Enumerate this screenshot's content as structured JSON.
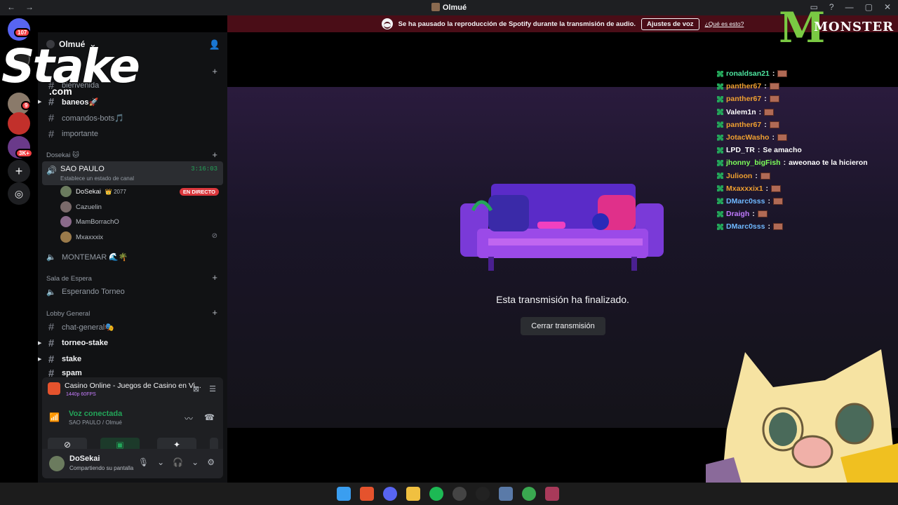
{
  "window": {
    "title": "Olmué"
  },
  "notice": {
    "text": "Se ha pausado la reproducción de Spotify durante la transmisión de audio.",
    "button": "Ajustes de voz",
    "link": "¿Qué es esto?"
  },
  "rail": {
    "badge_top": "107",
    "badge_mid": "9",
    "badge_low": "3K+"
  },
  "overlay": {
    "stake_word": "Stake",
    "stake_domain": ".com",
    "monster_word": "MONSTER",
    "monster_mark": "M"
  },
  "server": {
    "name": "Olmué"
  },
  "channels": {
    "top": [
      {
        "name": "bienvenida"
      },
      {
        "name": "baneos🚀"
      },
      {
        "name": "comandos-bots🎵"
      },
      {
        "name": "importante"
      }
    ],
    "cat_dosekai": "Dosekai 🐱",
    "voice_active": {
      "name": "SAO PAULO",
      "status": "Establece un estado de canal",
      "time": "3:16:03"
    },
    "voice_users": [
      {
        "name": "DoSekai",
        "extra": "👑 2077",
        "live": "EN DIRECTO"
      },
      {
        "name": "Cazuelin"
      },
      {
        "name": "MamBorrachO"
      },
      {
        "name": "Mxaxxxix"
      }
    ],
    "montemar": "MONTEMAR 🌊🌴",
    "cat_sala": "Sala de Espera",
    "esperando": "Esperando Torneo",
    "cat_lobby": "Lobby General",
    "lobby": [
      {
        "name": "chat-general🎭"
      },
      {
        "name": "torneo-stake"
      },
      {
        "name": "stake"
      },
      {
        "name": "spam"
      }
    ]
  },
  "stream_panel": {
    "title": "Casino Online - Juegos de Casino en Vi...",
    "quality": "1440p 60FPS"
  },
  "voice_panel": {
    "status": "Voz conectada",
    "location": "SAO PAULO / Olmué"
  },
  "user_panel": {
    "name": "DoSekai",
    "status": "Compartiendo su pantalla"
  },
  "stage": {
    "message": "Esta transmisión ha finalizado.",
    "close_button": "Cerrar transmisión"
  },
  "chat": [
    {
      "user": "ronaldsan21",
      "color": "#4ee6a0",
      "text": ""
    },
    {
      "user": "panther67",
      "color": "#f0a030",
      "text": ""
    },
    {
      "user": "panther67",
      "color": "#f0a030",
      "text": ""
    },
    {
      "user": "Valem1n",
      "color": "#ffffff",
      "text": ""
    },
    {
      "user": "panther67",
      "color": "#f0a030",
      "text": ""
    },
    {
      "user": "JotacWasho",
      "color": "#f0a030",
      "text": ""
    },
    {
      "user": "LPD_TR",
      "color": "#ffffff",
      "text": "Se amacho"
    },
    {
      "user": "jhonny_bigFish",
      "color": "#7dff5a",
      "text": "aweonao te la hicieron"
    },
    {
      "user": "Julioon",
      "color": "#f0a030",
      "text": ""
    },
    {
      "user": "Mxaxxxix1",
      "color": "#f0a030",
      "text": ""
    },
    {
      "user": "DMarc0sss",
      "color": "#6fb8ff",
      "text": ""
    },
    {
      "user": "Draigh",
      "color": "#c07aff",
      "text": ""
    },
    {
      "user": "DMarc0sss",
      "color": "#6fb8ff",
      "text": ""
    }
  ]
}
